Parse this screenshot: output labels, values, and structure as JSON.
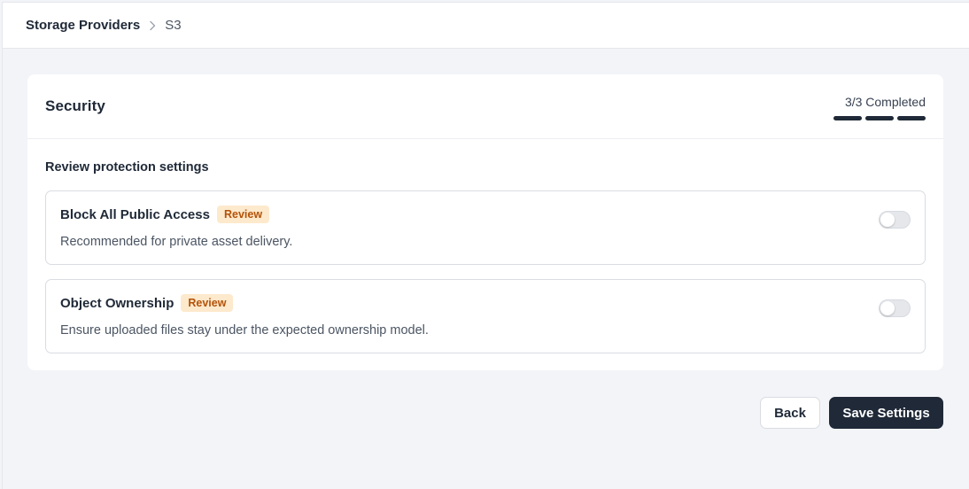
{
  "breadcrumb": {
    "root": "Storage Providers",
    "current": "S3"
  },
  "card": {
    "title": "Security",
    "progress": {
      "label": "3/3 Completed",
      "completed": 3,
      "total": 3
    },
    "section_label": "Review protection settings",
    "options": [
      {
        "title": "Block All Public Access",
        "badge": "Review",
        "description": "Recommended for private asset delivery.",
        "enabled": false
      },
      {
        "title": "Object Ownership",
        "badge": "Review",
        "description": "Ensure uploaded files stay under the expected ownership model.",
        "enabled": false
      }
    ]
  },
  "actions": {
    "back_label": "Back",
    "save_label": "Save Settings"
  },
  "colors": {
    "primary": "#1f2937",
    "badge_bg": "#fde9cc",
    "badge_text": "#b45309",
    "page_bg": "#f3f4f8"
  }
}
